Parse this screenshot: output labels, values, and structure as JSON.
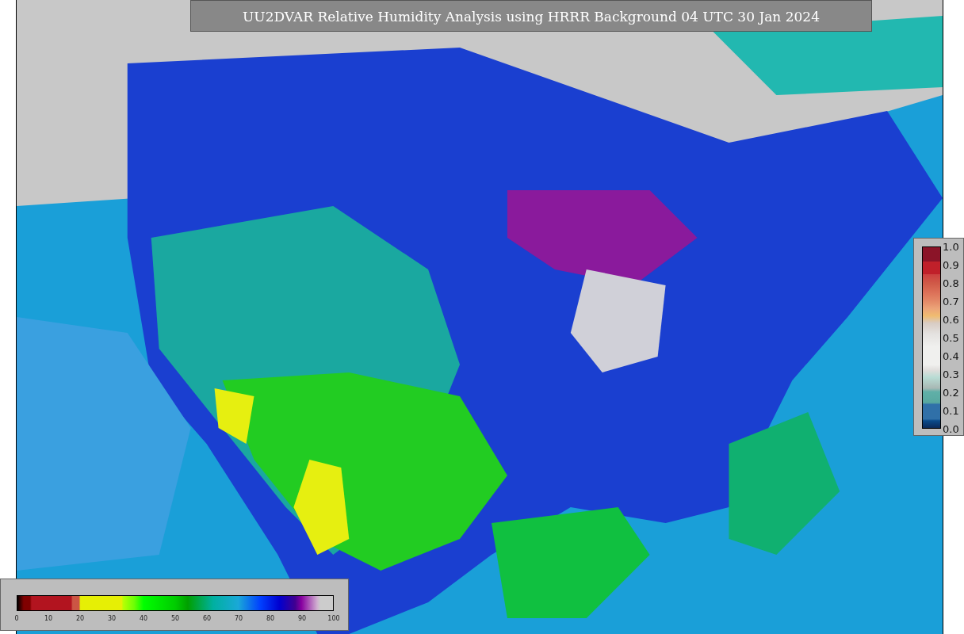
{
  "title": "UU2DVAR Relative Humidity Analysis using HRRR Background 04 UTC 30 Jan 2024",
  "humidity_colorbar": {
    "ticks": [
      "0",
      "10",
      "20",
      "30",
      "40",
      "50",
      "60",
      "70",
      "80",
      "90",
      "100"
    ]
  },
  "observation_colorbar": {
    "ticks": [
      "1.0",
      "0.9",
      "0.8",
      "0.7",
      "0.6",
      "0.5",
      "0.4",
      "0.3",
      "0.2",
      "0.1",
      "0.0"
    ]
  }
}
